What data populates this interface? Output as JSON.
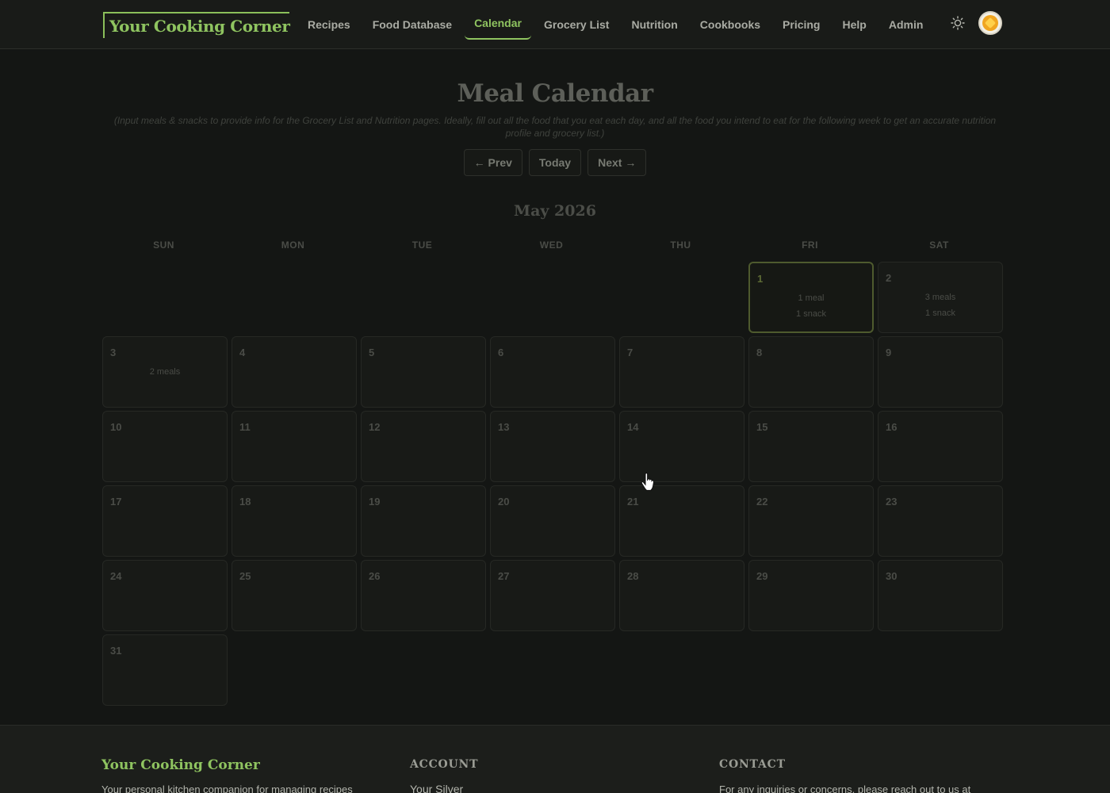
{
  "header": {
    "brand": "Your Cooking Corner",
    "nav": [
      {
        "label": "Recipes",
        "active": false
      },
      {
        "label": "Food Database",
        "active": false
      },
      {
        "label": "Calendar",
        "active": true
      },
      {
        "label": "Grocery List",
        "active": false
      },
      {
        "label": "Nutrition",
        "active": false
      },
      {
        "label": "Cookbooks",
        "active": false
      },
      {
        "label": "Pricing",
        "active": false
      },
      {
        "label": "Help",
        "active": false
      },
      {
        "label": "Admin",
        "active": false
      }
    ],
    "theme_icon": "sun-icon",
    "avatar_icon": "user-avatar"
  },
  "page": {
    "title": "Meal Calendar",
    "subtitle": "(Input meals & snacks to provide info for the Grocery List and Nutrition pages. Ideally, fill out all the food that you eat each day, and all the food you intend to eat for the following week to get an accurate nutrition profile and grocery list.)",
    "prev_label": "← Prev",
    "today_label": "Today",
    "next_label": "Next →",
    "month_label": "May 2026"
  },
  "calendar": {
    "weekdays": [
      "SUN",
      "MON",
      "TUE",
      "WED",
      "THU",
      "FRI",
      "SAT"
    ],
    "first_weekday_index": 5,
    "days_in_month": 31,
    "today": 1,
    "entries": {
      "1": [
        "1 meal",
        "1 snack"
      ],
      "2": [
        "3 meals",
        "1 snack"
      ],
      "3": [
        "2 meals"
      ]
    }
  },
  "footer": {
    "brand": "Your Cooking Corner",
    "description": "Your personal kitchen companion for managing recipes",
    "account_heading": "ACCOUNT",
    "account_link": "Your Silver",
    "contact_heading": "CONTACT",
    "contact_text": "For any inquiries or concerns, please reach out to us at"
  },
  "colors": {
    "accent": "#8fc460",
    "background": "#141614",
    "today_border": "#4e5a2e"
  }
}
